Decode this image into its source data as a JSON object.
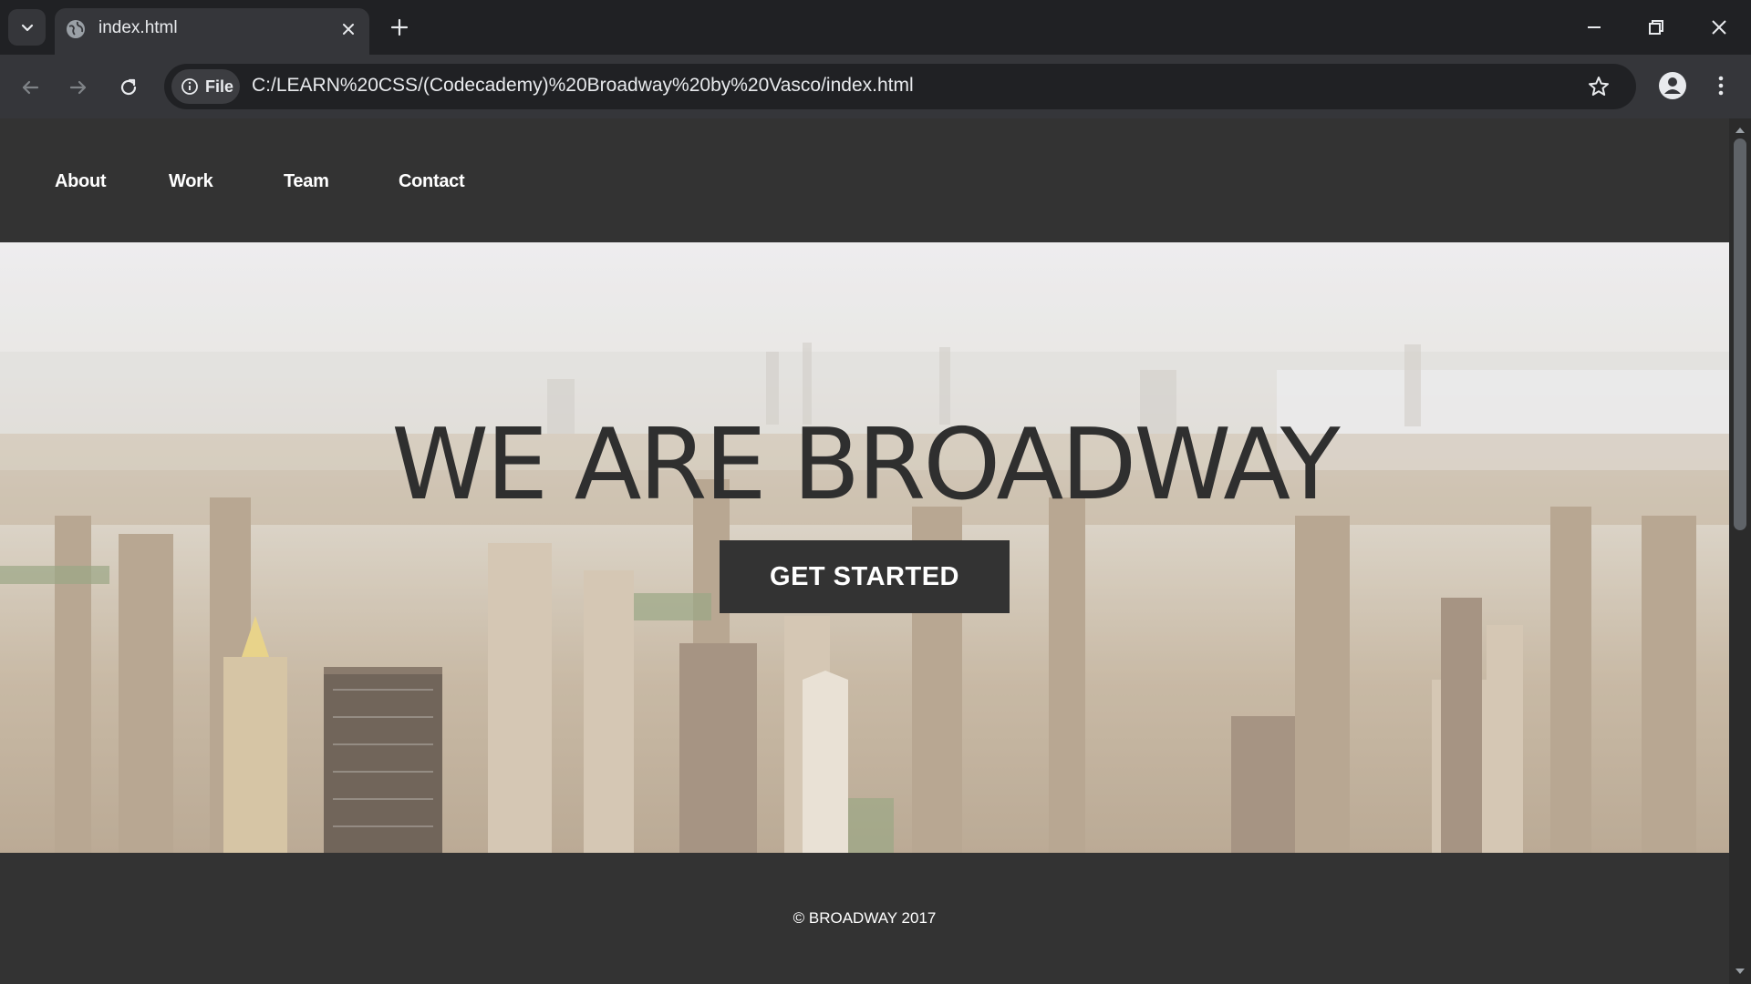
{
  "browser": {
    "tab": {
      "title": "index.html"
    },
    "address": {
      "chip_label": "File",
      "url": "C:/LEARN%20CSS/(Codecademy)%20Broadway%20by%20Vasco/index.html"
    },
    "icons": {
      "tab_search": "chevron-down-icon",
      "favicon": "globe-icon",
      "tab_close": "close-icon",
      "new_tab": "plus-icon",
      "minimize": "minimize-icon",
      "restore": "restore-icon",
      "window_close": "close-icon",
      "back": "arrow-left-icon",
      "forward": "arrow-right-icon",
      "reload": "reload-icon",
      "site_info": "info-icon",
      "bookmark": "star-icon",
      "profile": "person-icon",
      "menu": "kebab-menu-icon"
    }
  },
  "page": {
    "nav": {
      "items": [
        {
          "label": "About"
        },
        {
          "label": "Work"
        },
        {
          "label": "Team"
        },
        {
          "label": "Contact"
        }
      ]
    },
    "hero": {
      "title": "WE ARE BROADWAY",
      "button_label": "GET STARTED"
    },
    "footer": {
      "copyright": "© BROADWAY 2017"
    },
    "colors": {
      "nav_bg": "#333333",
      "text_light": "#ffffff",
      "hero_title": "#2f2f2f",
      "button_bg": "#333333"
    }
  }
}
